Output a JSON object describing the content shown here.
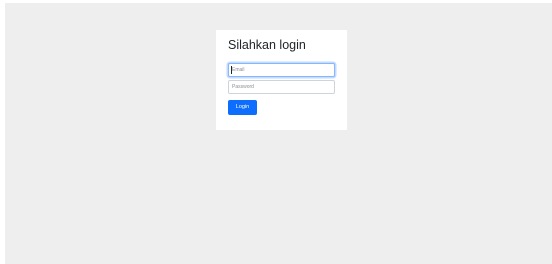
{
  "login": {
    "title": "Silahkan login",
    "email_placeholder": "Email",
    "password_placeholder": "Password",
    "submit_label": "Login"
  },
  "colors": {
    "background": "#eeeeee",
    "card": "#ffffff",
    "primary": "#0d6efd",
    "focus_border": "#86b7fe"
  }
}
